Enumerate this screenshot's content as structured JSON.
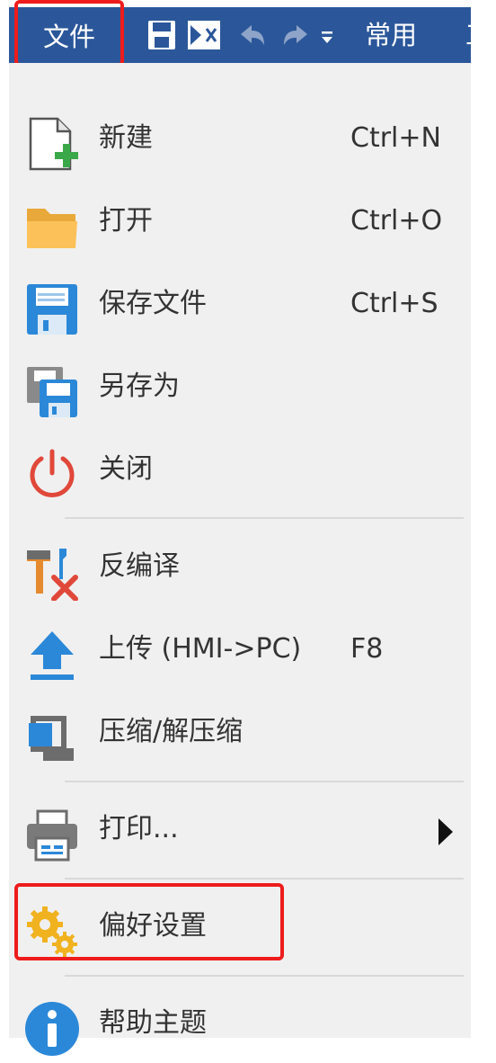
{
  "titlebar": {
    "file_tab": "文件",
    "tab_common": "常用",
    "tab_next": "工"
  },
  "menu": {
    "new": {
      "label": "新建",
      "shortcut": "Ctrl+N"
    },
    "open": {
      "label": "打开",
      "shortcut": "Ctrl+O"
    },
    "save": {
      "label": "保存文件",
      "shortcut": "Ctrl+S"
    },
    "save_as": {
      "label": "另存为"
    },
    "close": {
      "label": "关闭"
    },
    "decompile": {
      "label": "反编译"
    },
    "upload": {
      "label": "上传 (HMI->PC)",
      "shortcut": "F8"
    },
    "compress": {
      "label": "压缩/解压缩"
    },
    "print": {
      "label": "打印..."
    },
    "preferences": {
      "label": "偏好设置"
    },
    "help": {
      "label": "帮助主题"
    }
  },
  "colors": {
    "ribbon": "#2b579a",
    "menu_bg": "#f0f0f0",
    "highlight": "#ee1c1c"
  },
  "icons": {
    "new": "new-file-icon",
    "open": "folder-icon",
    "save": "floppy-disk-icon",
    "save_as": "save-as-icon",
    "close": "power-icon",
    "decompile": "tools-icon",
    "upload": "upload-arrow-icon",
    "compress": "compress-icon",
    "print": "printer-icon",
    "preferences": "gears-icon",
    "help": "info-icon"
  }
}
